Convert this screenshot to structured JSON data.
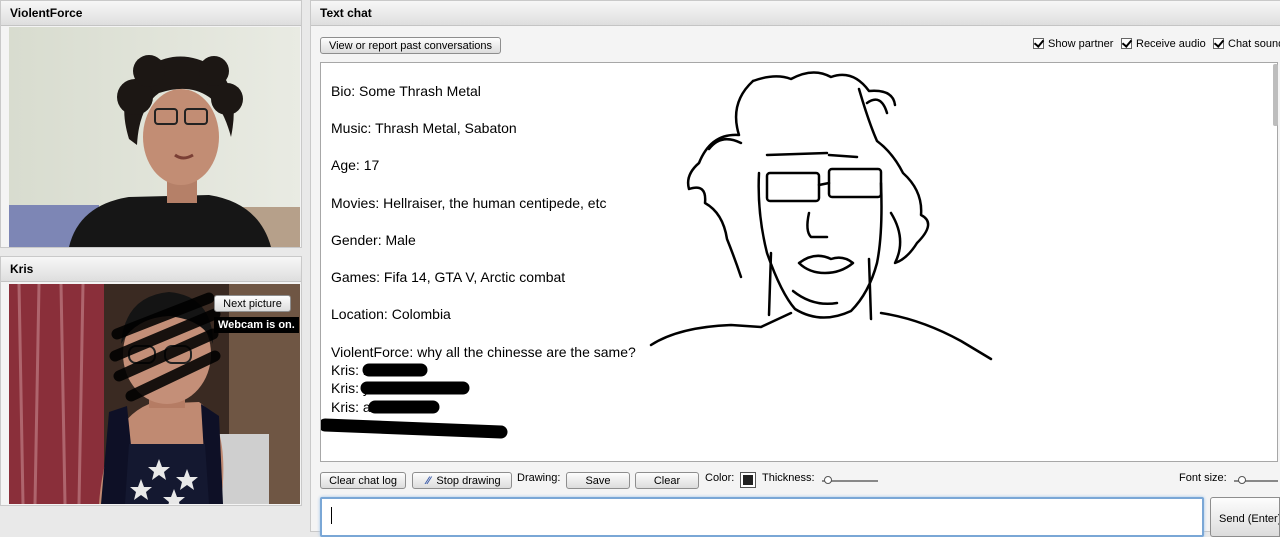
{
  "panels": {
    "partner": {
      "title": "ViolentForce"
    },
    "self": {
      "title": "Kris",
      "next_picture_label": "Next picture",
      "webcam_status": "Webcam is on."
    },
    "chat": {
      "title": "Text chat"
    }
  },
  "chat_header": {
    "view_report_label": "View or report past conversations",
    "show_partner_label": "Show partner",
    "receive_audio_label": "Receive audio",
    "chat_sound_label": "Chat sound"
  },
  "chat_log": {
    "lines": [
      "Bio: Some Thrash Metal",
      "Music: Thrash Metal, Sabaton",
      "Age: 17",
      "Movies: Hellraiser, the human centipede, etc",
      "Gender: Male",
      "Games: Fifa 14, GTA V, Arctic combat",
      "Location: Colombia",
      "ViolentForce: why all the chinesse are the same?",
      "Kris: no",
      "Kris: y",
      "Kris: a",
      "e"
    ]
  },
  "toolbar": {
    "clear_chat_label": "Clear chat log",
    "stop_drawing_label": "Stop drawing",
    "drawing_label": "Drawing:",
    "save_label": "Save",
    "clear_label": "Clear",
    "color_label": "Color:",
    "thickness_label": "Thickness:",
    "font_size_label": "Font size:"
  },
  "composer": {
    "message_value": "",
    "send_label": "Send (Enter)"
  },
  "colors": {
    "input_focus_border": "#7aa7d6",
    "drawing_stroke": "#000000"
  }
}
